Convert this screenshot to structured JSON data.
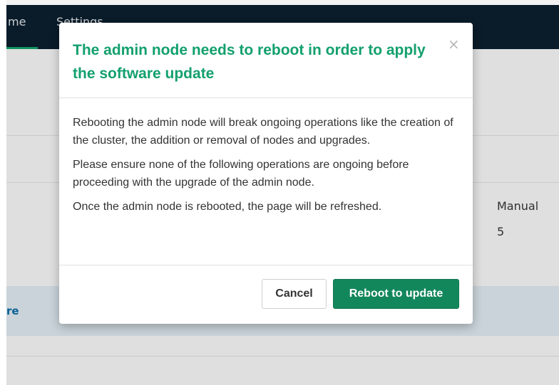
{
  "nav": {
    "tabs": [
      {
        "label": "me"
      },
      {
        "label": "Settings"
      }
    ]
  },
  "background": {
    "manual_label": "Manual",
    "manual_value": "5",
    "software_link": "re"
  },
  "modal": {
    "title": "The admin node needs to reboot in order to apply the software update",
    "close_symbol": "×",
    "paragraphs": [
      "Rebooting the admin node will break ongoing operations like the creation of the cluster, the addition or removal of nodes and upgrades.",
      "Please ensure none of the following operations are ongoing before proceeding with the upgrade of the admin node.",
      "Once the admin node is rebooted, the page will be refreshed."
    ],
    "cancel_label": "Cancel",
    "confirm_label": "Reboot to update"
  },
  "colors": {
    "accent": "#13a06e",
    "primary_button": "#13875c",
    "nav_background": "#0b1e2d"
  }
}
